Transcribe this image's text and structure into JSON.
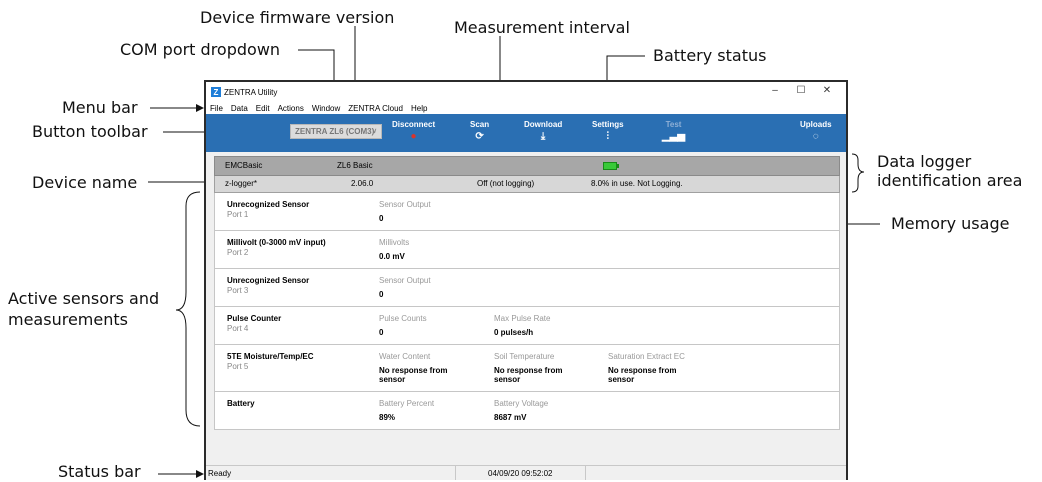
{
  "annotations": {
    "firmware_version": "Device firmware version",
    "measurement_interval": "Measurement interval",
    "com_port": "COM port dropdown",
    "battery_status": "Battery status",
    "menu_bar": "Menu bar",
    "button_toolbar": "Button toolbar",
    "data_logger_id_line1": "Data logger",
    "data_logger_id_line2": "identification area",
    "device_name": "Device name",
    "memory_usage": "Memory usage",
    "active_sensors_line1": "Active sensors and",
    "active_sensors_line2": "measurements",
    "status_bar": "Status bar"
  },
  "window": {
    "title": "ZENTRA Utility",
    "icon_letter": "Z",
    "minimize": "–",
    "maximize": "☐",
    "close": "✕"
  },
  "menu": [
    "File",
    "Data",
    "Edit",
    "Actions",
    "Window",
    "ZENTRA Cloud",
    "Help"
  ],
  "toolbar": {
    "com_port": "ZENTRA ZL6 (COM3)",
    "disconnect": "Disconnect",
    "scan": "Scan",
    "download": "Download",
    "settings": "Settings",
    "test": "Test",
    "uploads": "Uploads"
  },
  "device": {
    "type": "EMCBasic",
    "model": "ZL6 Basic",
    "name": "z-logger*",
    "firmware": "2.06.0",
    "interval": "Off (not logging)",
    "memory": "8.0% in use.  Not Logging."
  },
  "sensors": [
    {
      "name": "Unrecognized Sensor",
      "port": "Port 1",
      "measurements": [
        {
          "label": "Sensor Output",
          "value": "0"
        }
      ]
    },
    {
      "name": "Millivolt (0-3000 mV input)",
      "port": "Port 2",
      "measurements": [
        {
          "label": "Millivolts",
          "value": "0.0 mV"
        }
      ]
    },
    {
      "name": "Unrecognized Sensor",
      "port": "Port 3",
      "measurements": [
        {
          "label": "Sensor Output",
          "value": "0"
        }
      ]
    },
    {
      "name": "Pulse Counter",
      "port": "Port 4",
      "measurements": [
        {
          "label": "Pulse Counts",
          "value": "0"
        },
        {
          "label": "Max Pulse Rate",
          "value": "0 pulses/h"
        }
      ]
    },
    {
      "name": "5TE Moisture/Temp/EC",
      "port": "Port 5",
      "measurements": [
        {
          "label": "Water Content",
          "value": "No response from sensor"
        },
        {
          "label": "Soil Temperature",
          "value": "No response from sensor"
        },
        {
          "label": "Saturation Extract EC",
          "value": "No response from sensor"
        }
      ]
    },
    {
      "name": "Battery",
      "port": "",
      "measurements": [
        {
          "label": "Battery Percent",
          "value": "89%"
        },
        {
          "label": "Battery Voltage",
          "value": "8687 mV"
        }
      ]
    }
  ],
  "status": {
    "text": "Ready",
    "datetime": "04/09/20 09:52:02"
  },
  "colors": {
    "toolbar": "#2a6fb3",
    "battery": "#3ac93a",
    "disconnect_icon": "#d9342b"
  }
}
